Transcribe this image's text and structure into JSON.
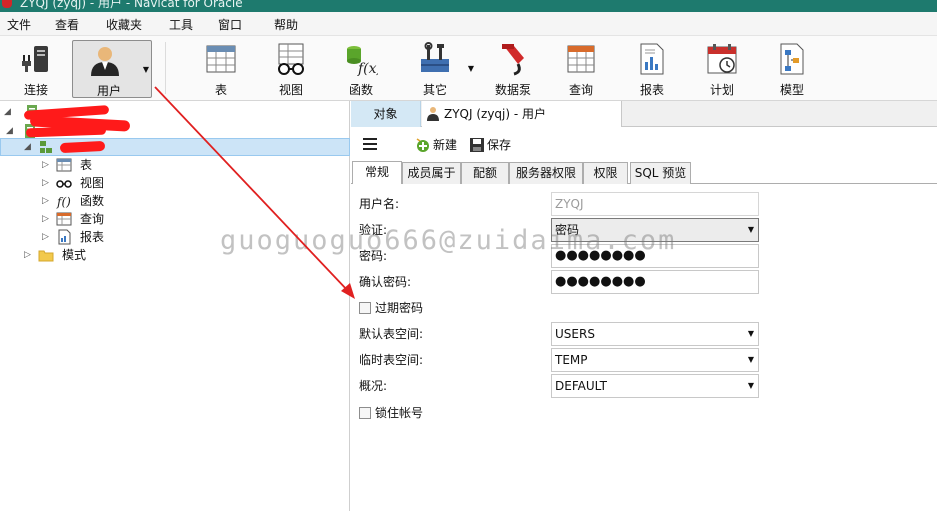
{
  "window": {
    "title": "ZYQJ (zyqj) - 用户 - Navicat for Oracle"
  },
  "menu": [
    "文件",
    "查看",
    "收藏夹",
    "工具",
    "窗口",
    "帮助"
  ],
  "toolbar": {
    "connect": "连接",
    "user": "用户",
    "table": "表",
    "view": "视图",
    "function": "函数",
    "other": "其它",
    "datapump": "数据泵",
    "query": "查询",
    "report": "报表",
    "schedule": "计划",
    "model": "模型"
  },
  "tree": {
    "children": [
      "表",
      "视图",
      "函数",
      "查询",
      "报表"
    ],
    "schema_folder": "模式"
  },
  "object_tabs": {
    "objects": "对象",
    "user_tab": "ZYQJ (zyqj) - 用户"
  },
  "editor_toolbar": {
    "new": "新建",
    "save": "保存"
  },
  "sub_tabs": [
    "常规",
    "成员属于",
    "配额",
    "服务器权限",
    "权限",
    "SQL 预览"
  ],
  "form": {
    "username_label": "用户名:",
    "username_value": "ZYQJ",
    "auth_label": "验证:",
    "auth_value": "密码",
    "password_label": "密码:",
    "password_value": "●●●●●●●●",
    "confirm_label": "确认密码:",
    "confirm_value": "●●●●●●●●",
    "expire_label": "过期密码",
    "default_ts_label": "默认表空间:",
    "default_ts_value": "USERS",
    "temp_ts_label": "临时表空间:",
    "temp_ts_value": "TEMP",
    "profile_label": "概况:",
    "profile_value": "DEFAULT",
    "lock_label": "锁住帐号"
  },
  "watermark": "guoguoguo666@zuidaima.com",
  "colors": {
    "titlebar": "#1e7a6e",
    "selection": "#cce4f7",
    "redact": "#ff1a1a",
    "arrow": "#e02020"
  }
}
